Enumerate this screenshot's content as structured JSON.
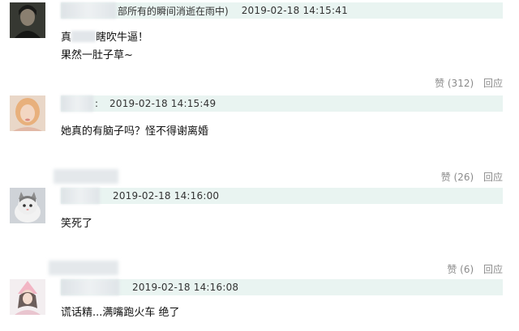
{
  "comments": [
    {
      "name_suffix": "部所有的瞬间消逝在雨中)",
      "timestamp": "2019-02-18 14:15:41",
      "lines": [
        "瞎吹牛逼！",
        "果然一肚子草~"
      ],
      "line1_prefix": "真",
      "likes": "赞 (312)",
      "reply": "回应"
    },
    {
      "name_suffix": ":",
      "timestamp": "2019-02-18 14:15:49",
      "lines": [
        "她真的有脑子吗？怪不得谢离婚"
      ],
      "likes": "赞 (26)",
      "reply": "回应"
    },
    {
      "name_suffix": "",
      "timestamp": "2019-02-18 14:16:00",
      "lines": [
        "笑死了"
      ],
      "likes": "赞 (6)",
      "reply": "回应"
    },
    {
      "name_suffix": "",
      "timestamp": "2019-02-18 14:16:08",
      "lines": [
        "谎话精...满嘴跑火车 绝了"
      ]
    }
  ]
}
